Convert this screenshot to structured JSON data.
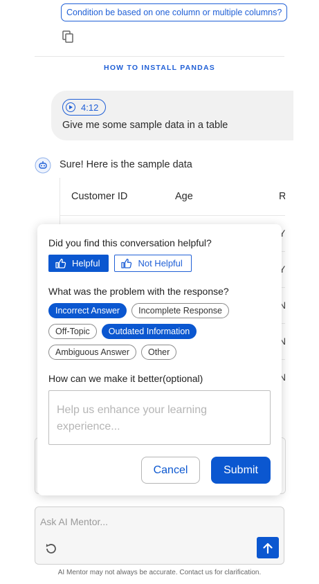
{
  "suggestion": "Condition be based on one column or multiple columns?",
  "section_link": "HOW TO INSTALL PANDAS",
  "user_message": {
    "audio_duration": "4:12",
    "text": "Give me some sample data in a table"
  },
  "bot_message": {
    "text": "Sure! Here is the sample data"
  },
  "table": {
    "headers": [
      "Customer ID",
      "Age",
      "R"
    ],
    "edge_glyphs": [
      "Y",
      "Y",
      "N",
      "N",
      "N"
    ]
  },
  "feedback": {
    "question_helpful": "Did you find this conversation helpful?",
    "helpful_label": "Helpful",
    "not_helpful_label": "Not Helpful",
    "question_problem": "What was the problem with the response?",
    "tags_row1": [
      {
        "label": "Incorrect Answer",
        "selected": true
      },
      {
        "label": "Incomplete Response",
        "selected": false
      }
    ],
    "tags_row2": [
      {
        "label": "Off-Topic",
        "selected": false
      },
      {
        "label": "Outdated Information",
        "selected": true
      }
    ],
    "tags_row3": [
      {
        "label": "Ambiguous Answer",
        "selected": false
      },
      {
        "label": "Other",
        "selected": false
      }
    ],
    "question_better": "How can we make it better(optional)",
    "textarea_placeholder": "Help us enhance your learning experience...",
    "cancel_label": "Cancel",
    "submit_label": "Submit"
  },
  "composer": {
    "placeholder": "Ask AI Mentor..."
  },
  "disclaimer": "AI Mentor may not always be accurate. Contact us for clarification.",
  "colors": {
    "primary": "#0b57d0",
    "link": "#1f5fd6"
  }
}
